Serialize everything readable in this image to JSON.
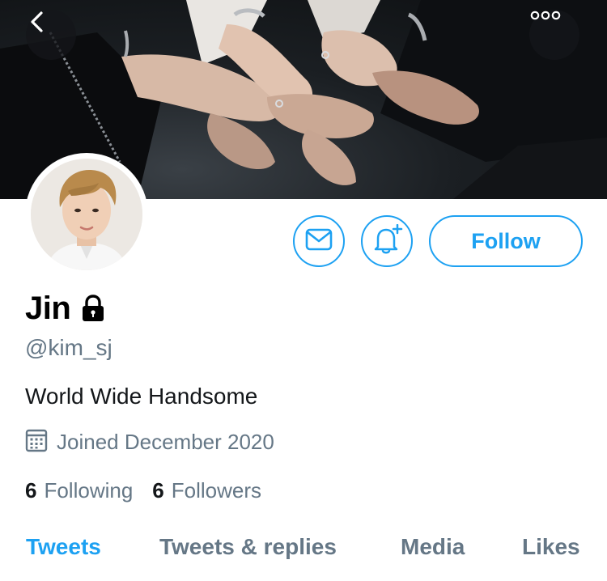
{
  "header": {
    "back_icon": "chevron-left-icon",
    "more_icon": "more-horizontal-icon"
  },
  "profile": {
    "display_name": "Jin",
    "protected_icon": "lock-icon",
    "handle": "@kim_sj",
    "bio": "World Wide Handsome",
    "joined": "Joined December 2020",
    "joined_icon": "calendar-icon"
  },
  "actions": {
    "message_icon": "envelope-icon",
    "notify_icon": "bell-plus-icon",
    "follow_label": "Follow"
  },
  "stats": {
    "following_count": "6",
    "following_label": "Following",
    "followers_count": "6",
    "followers_label": "Followers"
  },
  "tabs": [
    {
      "label": "Tweets",
      "active": true
    },
    {
      "label": "Tweets & replies",
      "active": false
    },
    {
      "label": "Media",
      "active": false
    },
    {
      "label": "Likes",
      "active": false
    }
  ],
  "colors": {
    "accent": "#1da1f2",
    "secondary_text": "#657786",
    "primary_text": "#14171a"
  }
}
